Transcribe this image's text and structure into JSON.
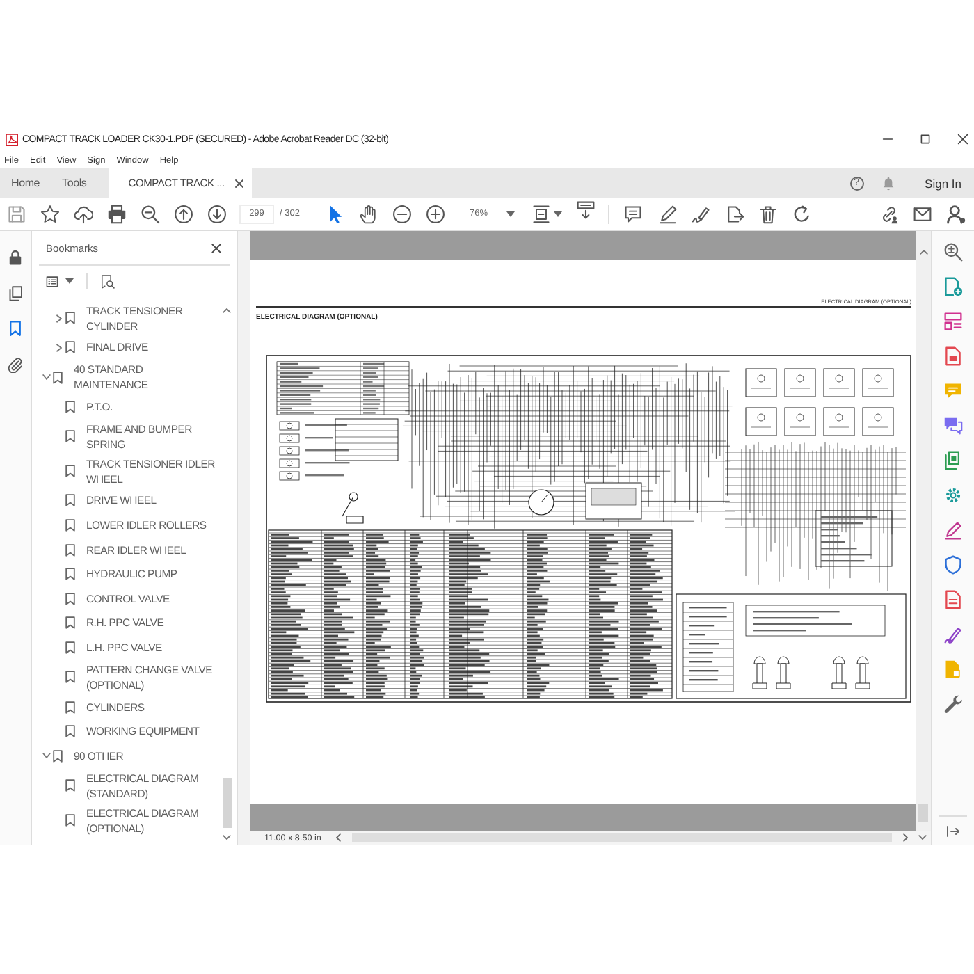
{
  "window": {
    "title": "COMPACT TRACK LOADER CK30-1.PDF (SECURED) - Adobe Acrobat Reader DC (32-bit)"
  },
  "menu": [
    "File",
    "Edit",
    "View",
    "Sign",
    "Window",
    "Help"
  ],
  "tabs": [
    {
      "label": "Home",
      "selected": false,
      "closable": false
    },
    {
      "label": "Tools",
      "selected": false,
      "closable": false
    },
    {
      "label": "COMPACT TRACK ...",
      "selected": true,
      "closable": true
    }
  ],
  "help": "?",
  "sign_in": "Sign In",
  "toolbar": {
    "page": "299",
    "page_count": "/ 302",
    "zoom": "76%"
  },
  "nav_tabs": [
    {
      "selected": false
    },
    {
      "selected": false
    },
    {
      "selected": true
    },
    {
      "selected": false
    }
  ],
  "bookmarks": {
    "title": "Bookmarks",
    "items": [
      {
        "children": [
          {
            "label": "TRACK TENSIONER CYLINDER",
            "expanded": false
          },
          {
            "label": "FINAL DRIVE",
            "expanded": false
          }
        ]
      },
      {
        "label": "40 STANDARD MAINTENANCE",
        "expanded": true,
        "children": [
          {
            "label": "P.T.O."
          },
          {
            "label": "FRAME AND BUMPER SPRING"
          },
          {
            "label": "TRACK TENSIONER IDLER WHEEL"
          },
          {
            "label": "DRIVE WHEEL"
          },
          {
            "label": "LOWER IDLER ROLLERS"
          },
          {
            "label": "REAR IDLER WHEEL"
          },
          {
            "label": "HYDRAULIC PUMP"
          },
          {
            "label": "CONTROL VALVE"
          },
          {
            "label": "R.H. PPC VALVE"
          },
          {
            "label": "L.H. PPC VALVE"
          },
          {
            "label": "PATTERN CHANGE VALVE (OPTIONAL)"
          },
          {
            "label": "CYLINDERS"
          },
          {
            "label": "WORKING EQUIPMENT"
          }
        ]
      },
      {
        "label": "90 OTHER",
        "expanded": true,
        "children": [
          {
            "label": "ELECTRICAL DIAGRAM (STANDARD)"
          },
          {
            "label": "ELECTRICAL DIAGRAM (OPTIONAL)"
          }
        ]
      }
    ]
  },
  "document": {
    "running_header": "ELECTRICAL DIAGRAM (OPTIONAL)",
    "title": "ELECTRICAL DIAGRAM (OPTIONAL)"
  },
  "status_bar": {
    "page_size": "11.00 x 8.50 in"
  }
}
